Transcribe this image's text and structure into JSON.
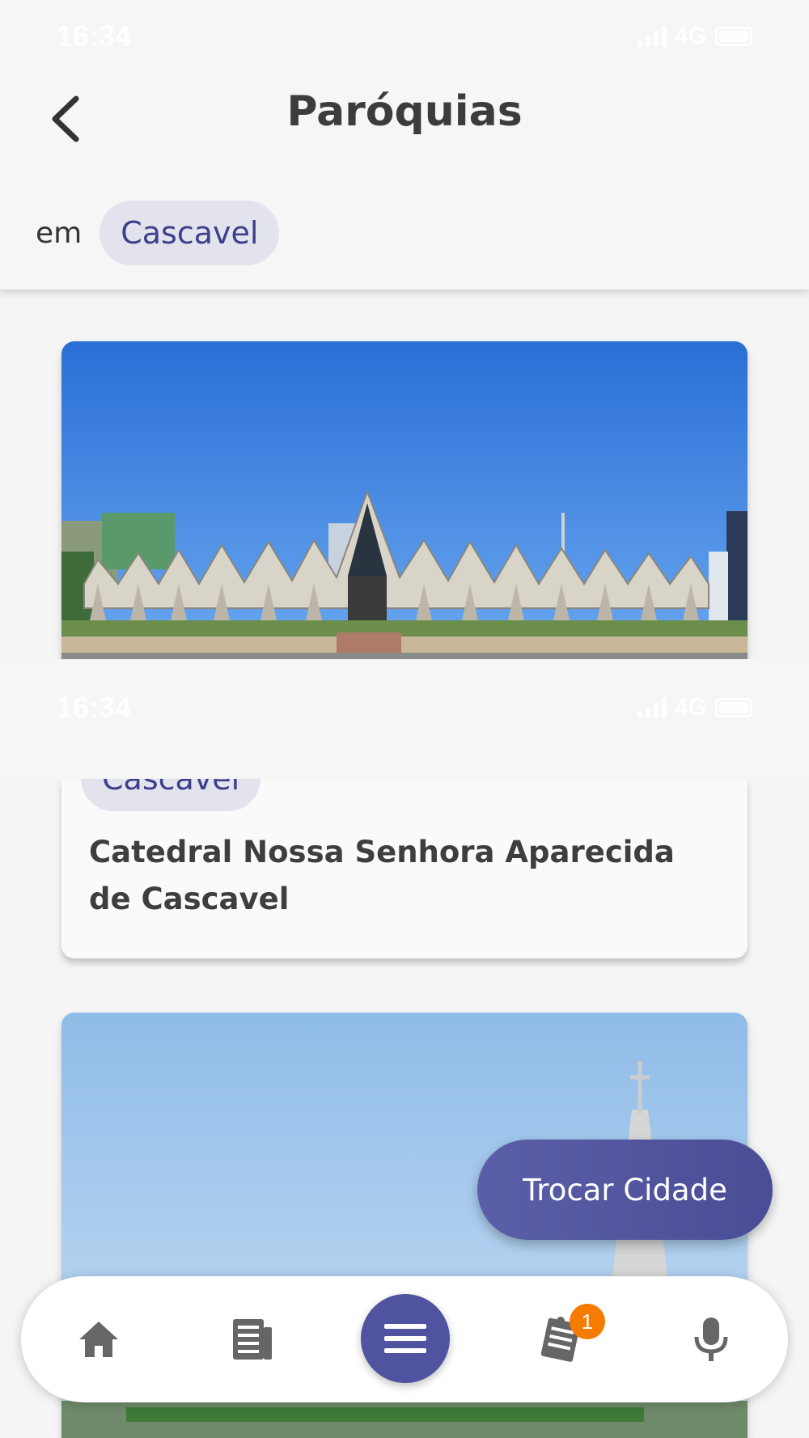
{
  "status": {
    "time": "16:34",
    "network": "4G"
  },
  "header": {
    "title": "Paróquias",
    "city_prefix": "em",
    "city": "Cascavel"
  },
  "cards": [
    {
      "city": "Cascavel",
      "title": "Catedral Nossa Senhora Aparecida de Cascavel",
      "image": "cathedral-photo"
    },
    {
      "image": "church-spire-photo"
    }
  ],
  "fab": {
    "label": "Trocar Cidade"
  },
  "bottom_nav": {
    "items": [
      {
        "icon": "home-icon"
      },
      {
        "icon": "news-icon"
      },
      {
        "icon": "menu-icon"
      },
      {
        "icon": "notes-icon",
        "badge": "1"
      },
      {
        "icon": "microphone-icon"
      }
    ]
  },
  "colors": {
    "accent": "#4f53a0",
    "chip_bg": "#e3e3ee",
    "chip_text": "#3b3f8c",
    "badge": "#f57c00"
  }
}
